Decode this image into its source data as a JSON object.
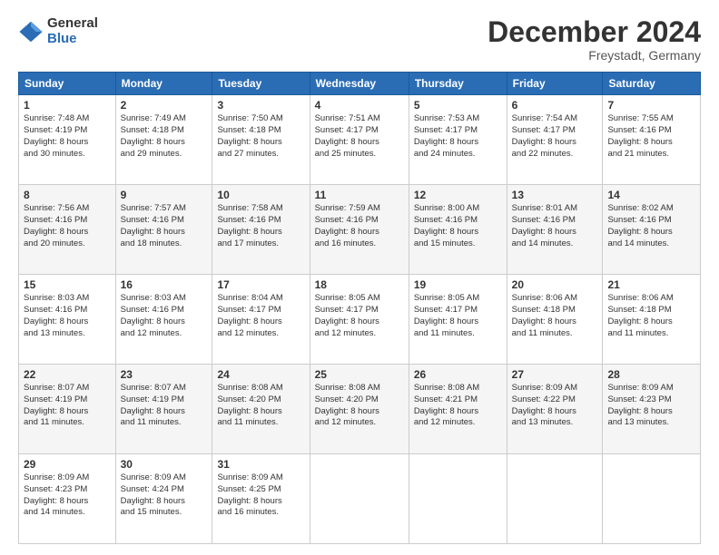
{
  "logo": {
    "general": "General",
    "blue": "Blue"
  },
  "title": "December 2024",
  "subtitle": "Freystadt, Germany",
  "days_header": [
    "Sunday",
    "Monday",
    "Tuesday",
    "Wednesday",
    "Thursday",
    "Friday",
    "Saturday"
  ],
  "weeks": [
    [
      {
        "day": "1",
        "info": "Sunrise: 7:48 AM\nSunset: 4:19 PM\nDaylight: 8 hours\nand 30 minutes."
      },
      {
        "day": "2",
        "info": "Sunrise: 7:49 AM\nSunset: 4:18 PM\nDaylight: 8 hours\nand 29 minutes."
      },
      {
        "day": "3",
        "info": "Sunrise: 7:50 AM\nSunset: 4:18 PM\nDaylight: 8 hours\nand 27 minutes."
      },
      {
        "day": "4",
        "info": "Sunrise: 7:51 AM\nSunset: 4:17 PM\nDaylight: 8 hours\nand 25 minutes."
      },
      {
        "day": "5",
        "info": "Sunrise: 7:53 AM\nSunset: 4:17 PM\nDaylight: 8 hours\nand 24 minutes."
      },
      {
        "day": "6",
        "info": "Sunrise: 7:54 AM\nSunset: 4:17 PM\nDaylight: 8 hours\nand 22 minutes."
      },
      {
        "day": "7",
        "info": "Sunrise: 7:55 AM\nSunset: 4:16 PM\nDaylight: 8 hours\nand 21 minutes."
      }
    ],
    [
      {
        "day": "8",
        "info": "Sunrise: 7:56 AM\nSunset: 4:16 PM\nDaylight: 8 hours\nand 20 minutes."
      },
      {
        "day": "9",
        "info": "Sunrise: 7:57 AM\nSunset: 4:16 PM\nDaylight: 8 hours\nand 18 minutes."
      },
      {
        "day": "10",
        "info": "Sunrise: 7:58 AM\nSunset: 4:16 PM\nDaylight: 8 hours\nand 17 minutes."
      },
      {
        "day": "11",
        "info": "Sunrise: 7:59 AM\nSunset: 4:16 PM\nDaylight: 8 hours\nand 16 minutes."
      },
      {
        "day": "12",
        "info": "Sunrise: 8:00 AM\nSunset: 4:16 PM\nDaylight: 8 hours\nand 15 minutes."
      },
      {
        "day": "13",
        "info": "Sunrise: 8:01 AM\nSunset: 4:16 PM\nDaylight: 8 hours\nand 14 minutes."
      },
      {
        "day": "14",
        "info": "Sunrise: 8:02 AM\nSunset: 4:16 PM\nDaylight: 8 hours\nand 14 minutes."
      }
    ],
    [
      {
        "day": "15",
        "info": "Sunrise: 8:03 AM\nSunset: 4:16 PM\nDaylight: 8 hours\nand 13 minutes."
      },
      {
        "day": "16",
        "info": "Sunrise: 8:03 AM\nSunset: 4:16 PM\nDaylight: 8 hours\nand 12 minutes."
      },
      {
        "day": "17",
        "info": "Sunrise: 8:04 AM\nSunset: 4:17 PM\nDaylight: 8 hours\nand 12 minutes."
      },
      {
        "day": "18",
        "info": "Sunrise: 8:05 AM\nSunset: 4:17 PM\nDaylight: 8 hours\nand 12 minutes."
      },
      {
        "day": "19",
        "info": "Sunrise: 8:05 AM\nSunset: 4:17 PM\nDaylight: 8 hours\nand 11 minutes."
      },
      {
        "day": "20",
        "info": "Sunrise: 8:06 AM\nSunset: 4:18 PM\nDaylight: 8 hours\nand 11 minutes."
      },
      {
        "day": "21",
        "info": "Sunrise: 8:06 AM\nSunset: 4:18 PM\nDaylight: 8 hours\nand 11 minutes."
      }
    ],
    [
      {
        "day": "22",
        "info": "Sunrise: 8:07 AM\nSunset: 4:19 PM\nDaylight: 8 hours\nand 11 minutes."
      },
      {
        "day": "23",
        "info": "Sunrise: 8:07 AM\nSunset: 4:19 PM\nDaylight: 8 hours\nand 11 minutes."
      },
      {
        "day": "24",
        "info": "Sunrise: 8:08 AM\nSunset: 4:20 PM\nDaylight: 8 hours\nand 11 minutes."
      },
      {
        "day": "25",
        "info": "Sunrise: 8:08 AM\nSunset: 4:20 PM\nDaylight: 8 hours\nand 12 minutes."
      },
      {
        "day": "26",
        "info": "Sunrise: 8:08 AM\nSunset: 4:21 PM\nDaylight: 8 hours\nand 12 minutes."
      },
      {
        "day": "27",
        "info": "Sunrise: 8:09 AM\nSunset: 4:22 PM\nDaylight: 8 hours\nand 13 minutes."
      },
      {
        "day": "28",
        "info": "Sunrise: 8:09 AM\nSunset: 4:23 PM\nDaylight: 8 hours\nand 13 minutes."
      }
    ],
    [
      {
        "day": "29",
        "info": "Sunrise: 8:09 AM\nSunset: 4:23 PM\nDaylight: 8 hours\nand 14 minutes."
      },
      {
        "day": "30",
        "info": "Sunrise: 8:09 AM\nSunset: 4:24 PM\nDaylight: 8 hours\nand 15 minutes."
      },
      {
        "day": "31",
        "info": "Sunrise: 8:09 AM\nSunset: 4:25 PM\nDaylight: 8 hours\nand 16 minutes."
      },
      null,
      null,
      null,
      null
    ]
  ]
}
